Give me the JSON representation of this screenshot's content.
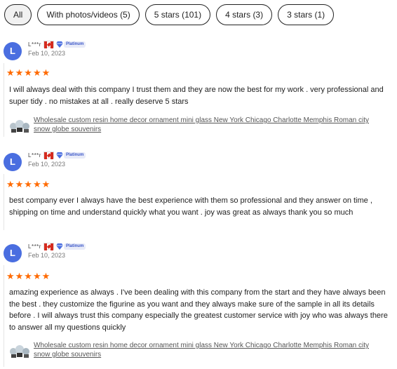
{
  "filters": [
    {
      "label": "All",
      "active": true
    },
    {
      "label": "With photos/videos (5)",
      "active": false
    },
    {
      "label": "5 stars (101)",
      "active": false
    },
    {
      "label": "4 stars (3)",
      "active": false
    },
    {
      "label": "3 stars (1)",
      "active": false
    }
  ],
  "badge_label": "Platinum",
  "accent_color": "#ff6a00",
  "avatar_color": "#4a6ee0",
  "reviews": [
    {
      "avatar_letter": "L",
      "username": "L***r",
      "date": "Feb 10, 2023",
      "rating": 5,
      "stars_text": "★★★★★",
      "text": "I will always deal with this company I trust them and they are now the best for my work . very professional and super tidy . no mistakes at all . really deserve 5 stars",
      "product": "Wholesale custom resin home decor ornament mini glass New York Chicago Charlotte Memphis Roman city snow globe souvenirs"
    },
    {
      "avatar_letter": "L",
      "username": "L***r",
      "date": "Feb 10, 2023",
      "rating": 5,
      "stars_text": "★★★★★",
      "text": "best company ever I always have the best experience with them so professional and they answer on time , shipping on time and understand quickly what you want . joy was great as always thank you so much",
      "product": ""
    },
    {
      "avatar_letter": "L",
      "username": "L***r",
      "date": "Feb 10, 2023",
      "rating": 5,
      "stars_text": "★★★★★",
      "text": "amazing experience as always . I've been dealing with this company from the start and they have always been the best . they customize the figurine as you want and they always make sure of the sample in all its details before . I will always trust this company especially the greatest customer service with joy who was always there to answer all my questions quickly",
      "product": "Wholesale custom resin home decor ornament mini glass New York Chicago Charlotte Memphis Roman city snow globe souvenirs"
    }
  ]
}
